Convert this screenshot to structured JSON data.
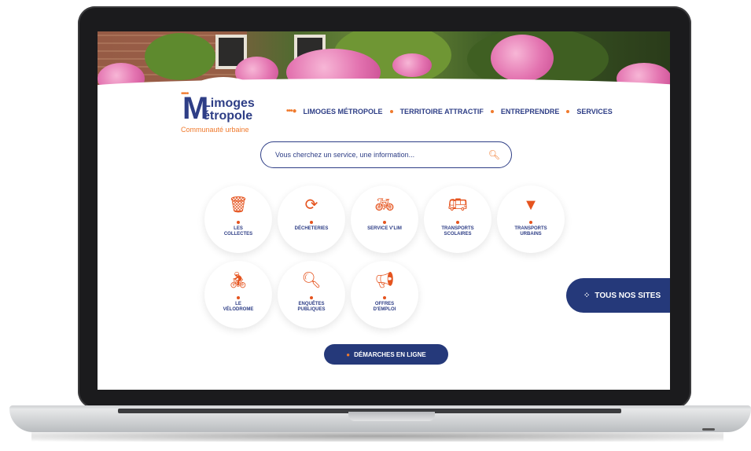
{
  "logo": {
    "letter": "M",
    "line1": "Limoges",
    "line2": "étropole",
    "subtitle": "Communauté urbaine"
  },
  "nav": {
    "items": [
      "LIMOGES MÉTROPOLE",
      "TERRITOIRE ATTRACTIF",
      "ENTREPRENDRE",
      "SERVICES"
    ]
  },
  "search": {
    "placeholder": "Vous cherchez un service, une information..."
  },
  "services": [
    {
      "icon": "trash-icon",
      "label": "LES\nCOLLECTES"
    },
    {
      "icon": "recycle-icon",
      "label": "DÉCHETERIES"
    },
    {
      "icon": "bicycle-icon",
      "label": "SERVICE V'LIM"
    },
    {
      "icon": "bus-icon",
      "label": "TRANSPORTS\nSCOLAIRES"
    },
    {
      "icon": "map-pin-icon",
      "label": "TRANSPORTS\nURBAINS"
    },
    {
      "icon": "cyclist-icon",
      "label": "LE\nVÉLODROME"
    },
    {
      "icon": "search-icon",
      "label": "ENQUÊTES\nPUBLIQUES"
    },
    {
      "icon": "megaphone-icon",
      "label": "OFFRES\nD'EMPLOI"
    }
  ],
  "tous_nos_sites": {
    "label": "TOUS NOS SITES"
  },
  "demarches": {
    "label": "DÉMARCHES EN LIGNE"
  },
  "colors": {
    "brand_blue": "#2e3e86",
    "accent_orange": "#f07a2d",
    "icon_red": "#e5541f",
    "button_blue": "#25397a"
  }
}
